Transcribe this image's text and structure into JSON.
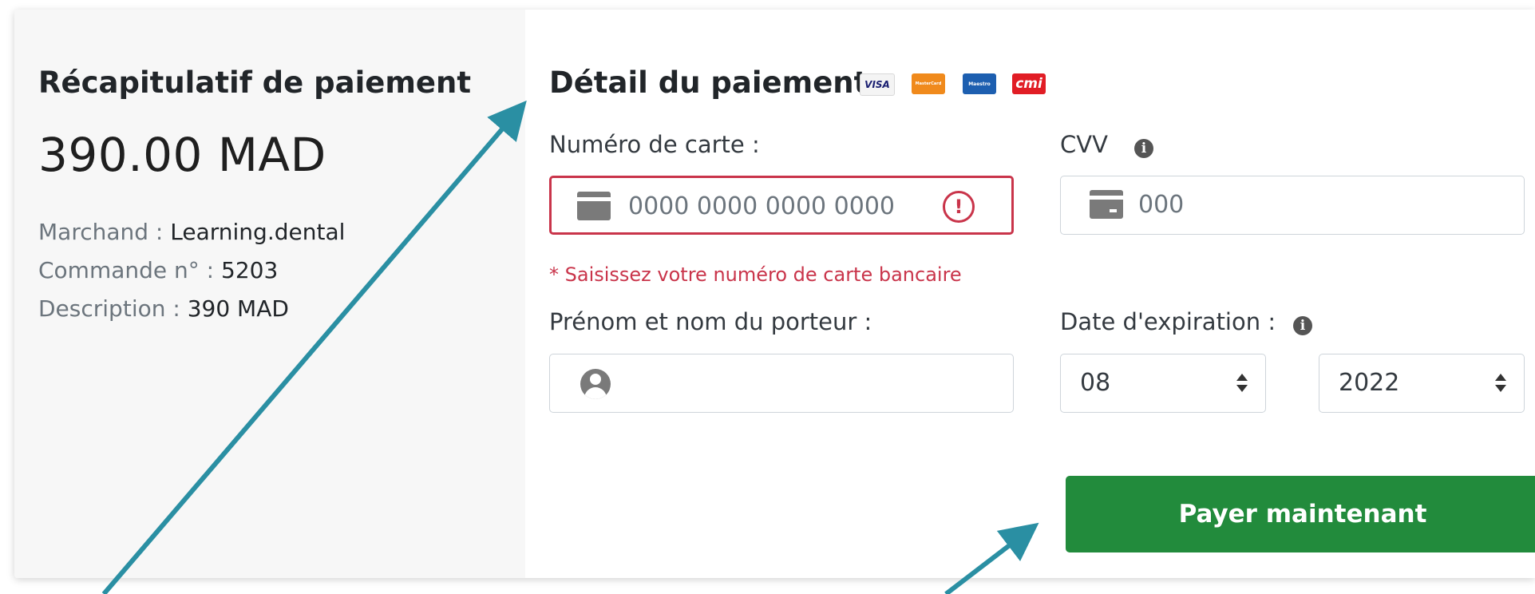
{
  "summary": {
    "title": "Récapitulatif de paiement",
    "amount": "390.00 MAD",
    "merchant_label": "Marchand : ",
    "merchant_value": "Learning.dental",
    "order_label": "Commande n° : ",
    "order_value": "5203",
    "description_label": "Description : ",
    "description_value": "390 MAD"
  },
  "details": {
    "title": "Détail du paiement",
    "brands": {
      "visa": "VISA",
      "mastercard": "MasterCard",
      "maestro": "Maestro",
      "cmi": "cmi"
    },
    "card_number": {
      "label": "Numéro de carte :",
      "placeholder": "0000 0000 0000 0000",
      "error_message": "* Saisissez votre numéro de carte bancaire"
    },
    "cvv": {
      "label": "CVV",
      "placeholder": "000"
    },
    "holder": {
      "label": "Prénom et nom du porteur :",
      "value": ""
    },
    "expiration": {
      "label": "Date d'expiration :",
      "month": "08",
      "year": "2022"
    },
    "pay_button_label": "Payer maintenant"
  },
  "colors": {
    "accent_green": "#228b3c",
    "error_red": "#c9344a",
    "arrow_teal": "#2a8fa3"
  },
  "icons": {
    "card": "credit-card-icon",
    "error": "error-icon",
    "info": "info-icon",
    "user": "user-icon"
  }
}
